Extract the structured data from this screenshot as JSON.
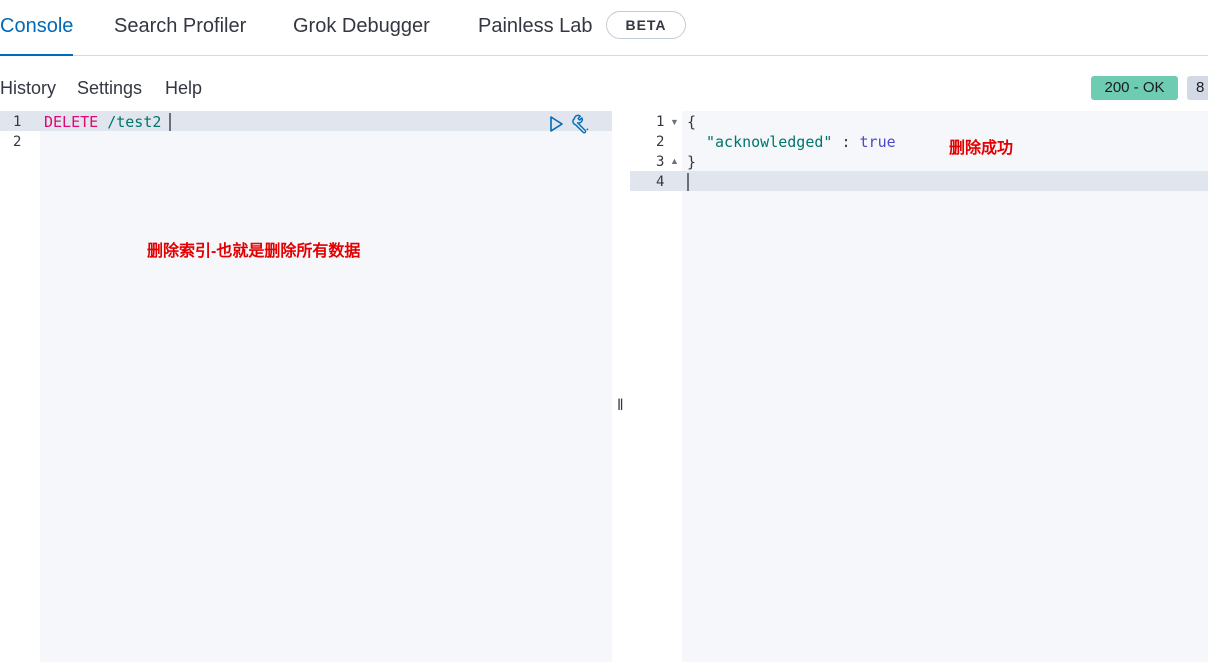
{
  "tabs": [
    {
      "label": "Console",
      "active": true
    },
    {
      "label": "Search Profiler",
      "active": false
    },
    {
      "label": "Grok Debugger",
      "active": false
    },
    {
      "label": "Painless Lab",
      "active": false
    }
  ],
  "beta_badge": "BETA",
  "menu": {
    "history": "History",
    "settings": "Settings",
    "help": "Help"
  },
  "status": {
    "code": "200 - OK",
    "time": "8",
    "color": "#6dccb1"
  },
  "editor": {
    "line_numbers": [
      "1",
      "2"
    ],
    "request_method": "DELETE",
    "request_path": "/test2",
    "icons": [
      "play-icon",
      "wrench-icon"
    ]
  },
  "output": {
    "line_numbers": [
      "1",
      "2",
      "3",
      "4"
    ],
    "open_brace": "{",
    "key": "\"acknowledged\"",
    "colon": " : ",
    "value": "true",
    "close_brace": "}"
  },
  "annotations": {
    "editor_note": "删除索引-也就是删除所有数据",
    "output_note": "删除成功"
  },
  "resizer_glyph": "‖"
}
